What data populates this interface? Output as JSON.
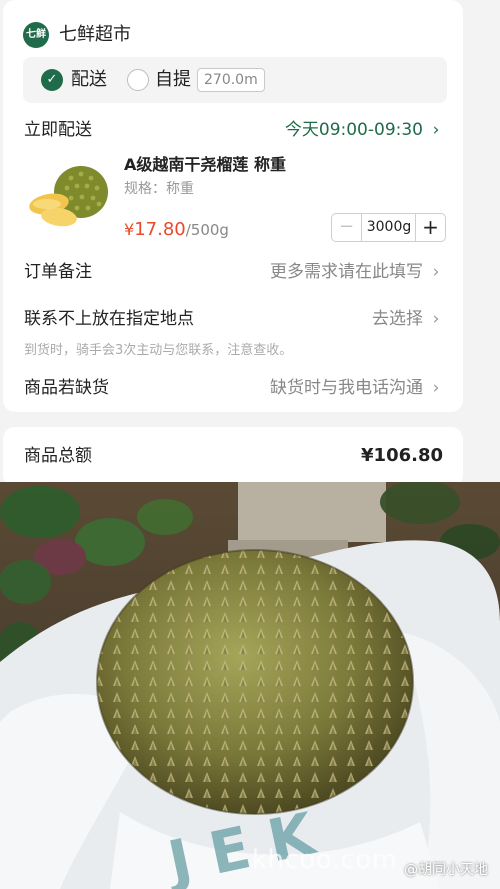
{
  "store": {
    "logo_text": "七鲜",
    "name": "七鲜超市"
  },
  "delivery_options": {
    "delivery_label": "配送",
    "delivery_checked": true,
    "pickup_label": "自提",
    "pickup_distance": "270.0m"
  },
  "delivery_time": {
    "label": "立即配送",
    "value": "今天09:00-09:30"
  },
  "product": {
    "name": "A级越南干尧榴莲 称重",
    "spec": "规格：称重",
    "price_currency": "¥",
    "price_amount": "17.80",
    "price_unit": "/500g",
    "quantity": "3000g"
  },
  "remark": {
    "label": "订单备注",
    "value": "更多需求请在此填写"
  },
  "dropoff": {
    "label": "联系不上放在指定地点",
    "value": "去选择"
  },
  "arrival_hint": "到货时，骑手会3次主动与您联系，注意查收。",
  "out_of_stock": {
    "label": "商品若缺货",
    "value": "缺货时与我电话沟通"
  },
  "total": {
    "label": "商品总额",
    "value": "¥106.80"
  },
  "watermarks": {
    "site": "khcoo.com",
    "credit": "@胡同小天地"
  },
  "colors": {
    "brand_green": "#1f6b4a",
    "price_red": "#e84a2a"
  }
}
